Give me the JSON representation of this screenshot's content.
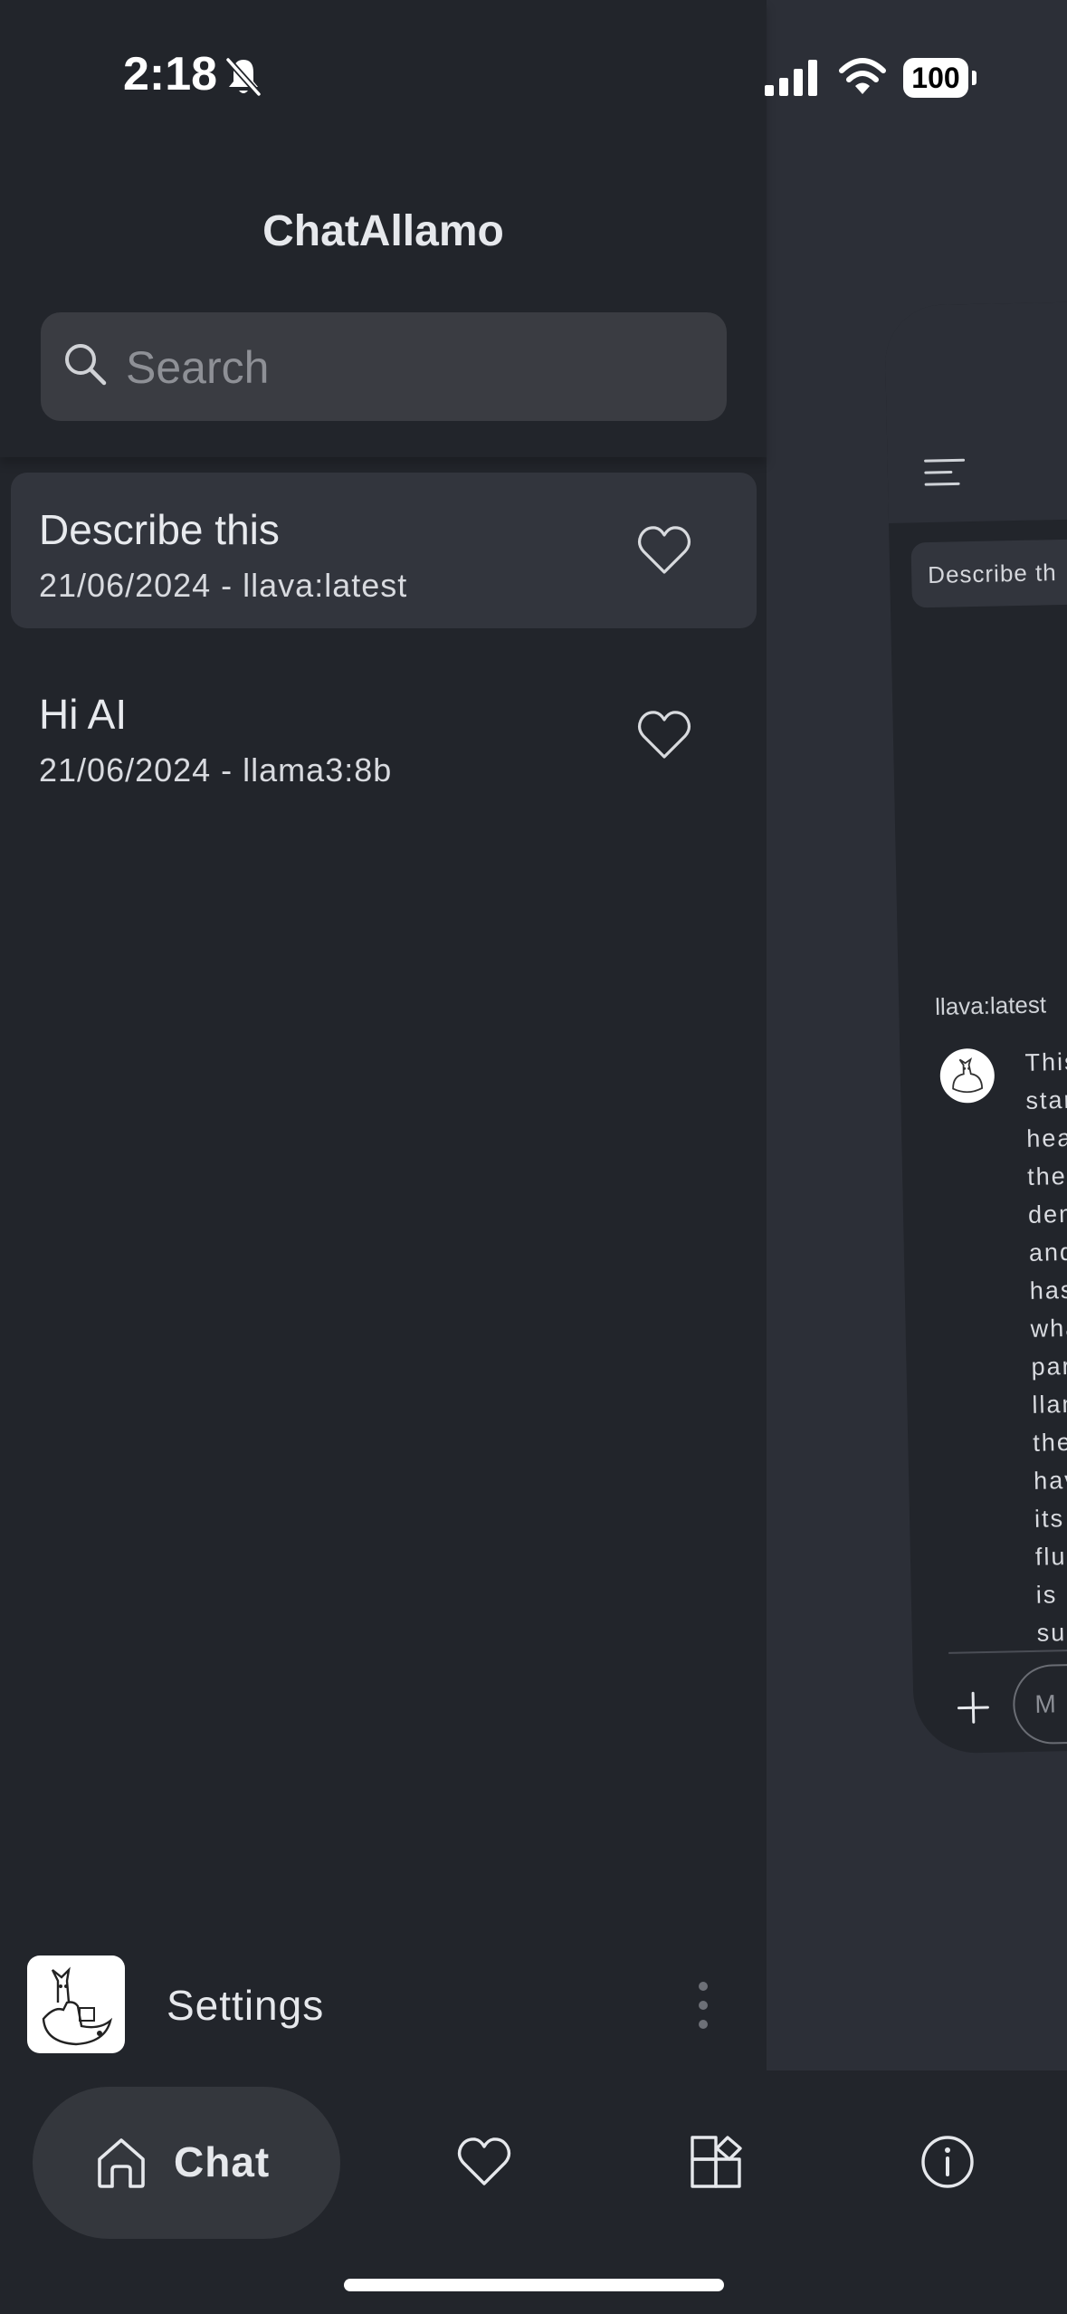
{
  "status_bar": {
    "time": "2:18",
    "battery": "100"
  },
  "drawer": {
    "title": "ChatAllamo",
    "search": {
      "placeholder": "Search",
      "value": ""
    },
    "chats": [
      {
        "title": "Describe this",
        "subtitle": "21/06/2024 - llava:latest",
        "active": true
      },
      {
        "title": "Hi AI",
        "subtitle": "21/06/2024 - llama3:8b",
        "active": false
      }
    ],
    "settings_label": "Settings"
  },
  "background_chat": {
    "chip_text": "Describe th",
    "model_tag": "llava:latest",
    "message_lines": [
      "This",
      "stan",
      "hea",
      "the",
      "dem",
      "and",
      "has",
      "wha",
      "par",
      "llan",
      "the",
      "hav",
      "its",
      "flu",
      "is p",
      "sur"
    ],
    "input_placeholder": "M"
  },
  "bottom_nav": {
    "items": [
      {
        "label": "Chat",
        "icon": "home-icon",
        "active": true
      },
      {
        "label": "",
        "icon": "heart-icon",
        "active": false
      },
      {
        "label": "",
        "icon": "models-icon",
        "active": false
      },
      {
        "label": "",
        "icon": "info-icon",
        "active": false
      }
    ]
  },
  "colors": {
    "background": "#22252b",
    "surface": "#32353d",
    "search_bg": "#3a3c42",
    "text": "#e6e8ec",
    "muted": "#8e9096"
  }
}
